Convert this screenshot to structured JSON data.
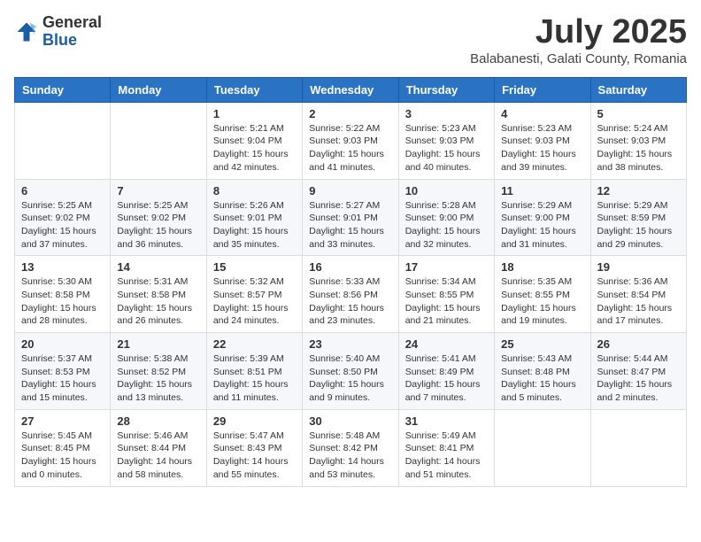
{
  "logo": {
    "general": "General",
    "blue": "Blue"
  },
  "title": {
    "month": "July 2025",
    "location": "Balabanesti, Galati County, Romania"
  },
  "headers": [
    "Sunday",
    "Monday",
    "Tuesday",
    "Wednesday",
    "Thursday",
    "Friday",
    "Saturday"
  ],
  "weeks": [
    [
      {
        "day": "",
        "info": ""
      },
      {
        "day": "",
        "info": ""
      },
      {
        "day": "1",
        "info": "Sunrise: 5:21 AM\nSunset: 9:04 PM\nDaylight: 15 hours and 42 minutes."
      },
      {
        "day": "2",
        "info": "Sunrise: 5:22 AM\nSunset: 9:03 PM\nDaylight: 15 hours and 41 minutes."
      },
      {
        "day": "3",
        "info": "Sunrise: 5:23 AM\nSunset: 9:03 PM\nDaylight: 15 hours and 40 minutes."
      },
      {
        "day": "4",
        "info": "Sunrise: 5:23 AM\nSunset: 9:03 PM\nDaylight: 15 hours and 39 minutes."
      },
      {
        "day": "5",
        "info": "Sunrise: 5:24 AM\nSunset: 9:03 PM\nDaylight: 15 hours and 38 minutes."
      }
    ],
    [
      {
        "day": "6",
        "info": "Sunrise: 5:25 AM\nSunset: 9:02 PM\nDaylight: 15 hours and 37 minutes."
      },
      {
        "day": "7",
        "info": "Sunrise: 5:25 AM\nSunset: 9:02 PM\nDaylight: 15 hours and 36 minutes."
      },
      {
        "day": "8",
        "info": "Sunrise: 5:26 AM\nSunset: 9:01 PM\nDaylight: 15 hours and 35 minutes."
      },
      {
        "day": "9",
        "info": "Sunrise: 5:27 AM\nSunset: 9:01 PM\nDaylight: 15 hours and 33 minutes."
      },
      {
        "day": "10",
        "info": "Sunrise: 5:28 AM\nSunset: 9:00 PM\nDaylight: 15 hours and 32 minutes."
      },
      {
        "day": "11",
        "info": "Sunrise: 5:29 AM\nSunset: 9:00 PM\nDaylight: 15 hours and 31 minutes."
      },
      {
        "day": "12",
        "info": "Sunrise: 5:29 AM\nSunset: 8:59 PM\nDaylight: 15 hours and 29 minutes."
      }
    ],
    [
      {
        "day": "13",
        "info": "Sunrise: 5:30 AM\nSunset: 8:58 PM\nDaylight: 15 hours and 28 minutes."
      },
      {
        "day": "14",
        "info": "Sunrise: 5:31 AM\nSunset: 8:58 PM\nDaylight: 15 hours and 26 minutes."
      },
      {
        "day": "15",
        "info": "Sunrise: 5:32 AM\nSunset: 8:57 PM\nDaylight: 15 hours and 24 minutes."
      },
      {
        "day": "16",
        "info": "Sunrise: 5:33 AM\nSunset: 8:56 PM\nDaylight: 15 hours and 23 minutes."
      },
      {
        "day": "17",
        "info": "Sunrise: 5:34 AM\nSunset: 8:55 PM\nDaylight: 15 hours and 21 minutes."
      },
      {
        "day": "18",
        "info": "Sunrise: 5:35 AM\nSunset: 8:55 PM\nDaylight: 15 hours and 19 minutes."
      },
      {
        "day": "19",
        "info": "Sunrise: 5:36 AM\nSunset: 8:54 PM\nDaylight: 15 hours and 17 minutes."
      }
    ],
    [
      {
        "day": "20",
        "info": "Sunrise: 5:37 AM\nSunset: 8:53 PM\nDaylight: 15 hours and 15 minutes."
      },
      {
        "day": "21",
        "info": "Sunrise: 5:38 AM\nSunset: 8:52 PM\nDaylight: 15 hours and 13 minutes."
      },
      {
        "day": "22",
        "info": "Sunrise: 5:39 AM\nSunset: 8:51 PM\nDaylight: 15 hours and 11 minutes."
      },
      {
        "day": "23",
        "info": "Sunrise: 5:40 AM\nSunset: 8:50 PM\nDaylight: 15 hours and 9 minutes."
      },
      {
        "day": "24",
        "info": "Sunrise: 5:41 AM\nSunset: 8:49 PM\nDaylight: 15 hours and 7 minutes."
      },
      {
        "day": "25",
        "info": "Sunrise: 5:43 AM\nSunset: 8:48 PM\nDaylight: 15 hours and 5 minutes."
      },
      {
        "day": "26",
        "info": "Sunrise: 5:44 AM\nSunset: 8:47 PM\nDaylight: 15 hours and 2 minutes."
      }
    ],
    [
      {
        "day": "27",
        "info": "Sunrise: 5:45 AM\nSunset: 8:45 PM\nDaylight: 15 hours and 0 minutes."
      },
      {
        "day": "28",
        "info": "Sunrise: 5:46 AM\nSunset: 8:44 PM\nDaylight: 14 hours and 58 minutes."
      },
      {
        "day": "29",
        "info": "Sunrise: 5:47 AM\nSunset: 8:43 PM\nDaylight: 14 hours and 55 minutes."
      },
      {
        "day": "30",
        "info": "Sunrise: 5:48 AM\nSunset: 8:42 PM\nDaylight: 14 hours and 53 minutes."
      },
      {
        "day": "31",
        "info": "Sunrise: 5:49 AM\nSunset: 8:41 PM\nDaylight: 14 hours and 51 minutes."
      },
      {
        "day": "",
        "info": ""
      },
      {
        "day": "",
        "info": ""
      }
    ]
  ]
}
